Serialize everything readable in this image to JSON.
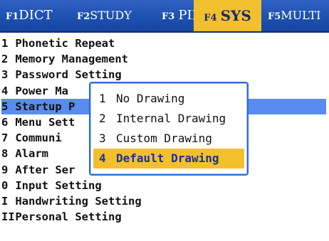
{
  "tabs": [
    {
      "key": "F1",
      "label": "DICT"
    },
    {
      "key": "F2",
      "label": "STUDY"
    },
    {
      "key": "F3",
      "label": "PIM"
    },
    {
      "key": "F4",
      "label": "SYS"
    },
    {
      "key": "F5",
      "label": "MULTI"
    }
  ],
  "menu": [
    {
      "num": "1",
      "label": "Phonetic Repeat"
    },
    {
      "num": "2",
      "label": "Memory Management"
    },
    {
      "num": "3",
      "label": "Password Setting"
    },
    {
      "num": "4",
      "label": "Power Ma"
    },
    {
      "num": "5",
      "label": "Startup P"
    },
    {
      "num": "6",
      "label": "Menu Sett"
    },
    {
      "num": "7",
      "label": "Communi"
    },
    {
      "num": "8",
      "label": "Alarm"
    },
    {
      "num": "9",
      "label": "After Ser"
    },
    {
      "num": "0",
      "label": "Input Setting"
    },
    {
      "num": "I",
      "label": "Handwriting Setting"
    },
    {
      "num": "II",
      "label": "Personal Setting"
    }
  ],
  "popup": [
    {
      "num": "1",
      "label": "No Drawing"
    },
    {
      "num": "2",
      "label": "Internal Drawing"
    },
    {
      "num": "3",
      "label": "Custom Drawing"
    },
    {
      "num": "4",
      "label": "Default Drawing"
    }
  ],
  "colors": {
    "tabbar": "#1c4fae",
    "active_tab": "#f2c02d",
    "selected_row": "#5a8bf0",
    "popup_border": "#2d6ad9"
  }
}
